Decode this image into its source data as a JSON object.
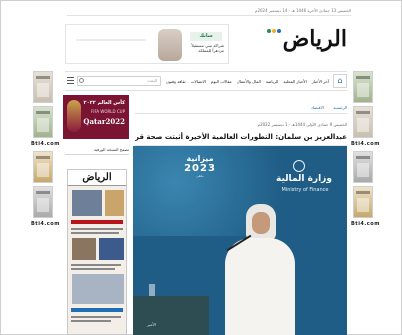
{
  "topbar": {
    "date_text": "الخميس 13 جمادى الآخرة 1446 هـ - 14 ديسمبر 2024م"
  },
  "ad": {
    "brand_label": "سابك",
    "text": "شراكة تبني مستقبلاً مزدهراً للمملكة"
  },
  "logo": {
    "word": "الرياض"
  },
  "nav": {
    "home_icon": "home-icon",
    "items": [
      "آخر الأخبار",
      "الأخبار المحلية",
      "الرياضة",
      "المال والأعمال",
      "مقالات اليوم",
      "الاتصالات",
      "ثقافة وفنون",
      "الرياض"
    ],
    "search_placeholder": "البحث",
    "menu_icon": "menu-icon"
  },
  "sidebar": {
    "label_top": "Bti4.com",
    "label_bottom": "Bti4.com"
  },
  "worldcup": {
    "title": "كأس العالم ٢٠٢٢",
    "subtitle": "FIFA WORLD CUP",
    "year": "Qatar2022"
  },
  "section": {
    "title": "تصفح النسخة الورقية"
  },
  "paper": {
    "masthead": "الرياض"
  },
  "breadcrumb": {
    "items": [
      "الرئيسية",
      "الاقتصاد"
    ]
  },
  "article": {
    "meta": "الخميس 9 جمادى الأولى 1444هـ - 1 ديسمبر 2022م",
    "headline": "عبدالعزيز بن سلمان: التطورات العالمية الأخيرة أثبتت صحة قرارات «أوبك+»"
  },
  "photo": {
    "ministry_ar": "وزارة المالية",
    "ministry_en": "Ministry of Finance",
    "badge_ar": "ميزانية",
    "badge_year": "2023",
    "badge_small": "ملتقى",
    "table_label": "الأمير"
  },
  "colors": {
    "accent_blue": "#1f6fb5",
    "brand_red": "#b8141b",
    "worldcup_maroon": "#7a1432",
    "photo_bg": "#1f5d86"
  }
}
